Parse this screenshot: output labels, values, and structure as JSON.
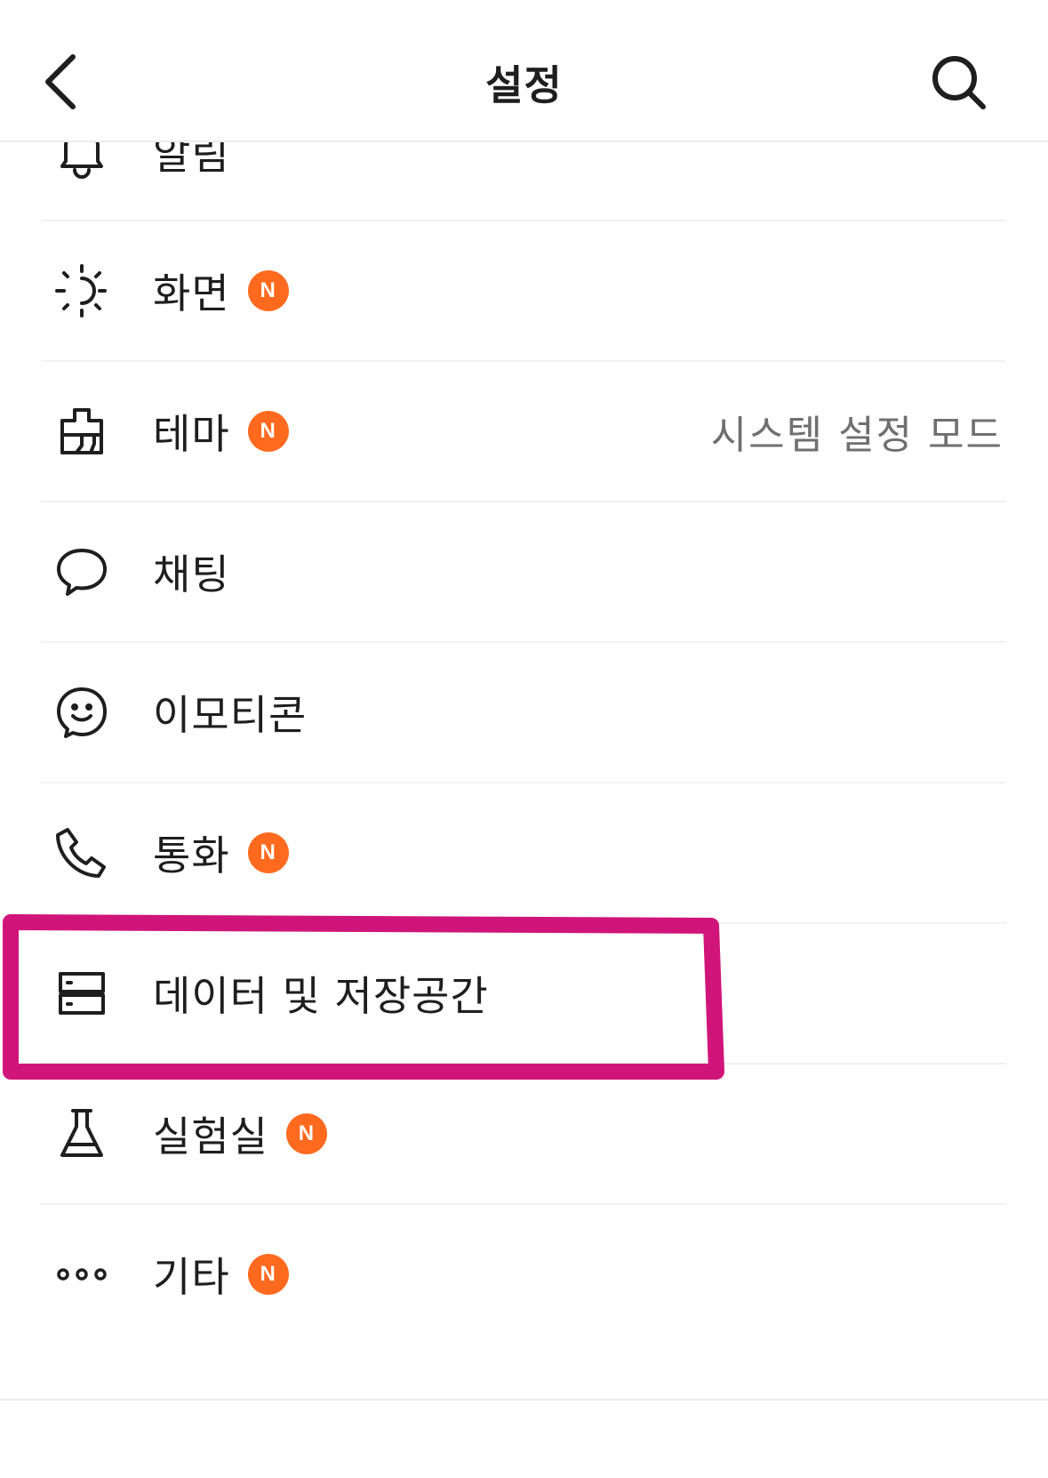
{
  "header": {
    "title": "설정",
    "back_icon": "chevron-left-icon",
    "search_icon": "search-icon"
  },
  "items": [
    {
      "label": "알림",
      "icon": "bell-icon",
      "badge": "",
      "value": ""
    },
    {
      "label": "화면",
      "icon": "brightness-icon",
      "badge": "N",
      "value": ""
    },
    {
      "label": "테마",
      "icon": "theme-brush-icon",
      "badge": "N",
      "value": "시스템 설정 모드"
    },
    {
      "label": "채팅",
      "icon": "chat-bubble-icon",
      "badge": "",
      "value": ""
    },
    {
      "label": "이모티콘",
      "icon": "emoticon-icon",
      "badge": "",
      "value": ""
    },
    {
      "label": "통화",
      "icon": "phone-icon",
      "badge": "N",
      "value": ""
    },
    {
      "label": "데이터 및 저장공간",
      "icon": "storage-icon",
      "badge": "",
      "value": "",
      "highlighted": true
    },
    {
      "label": "실험실",
      "icon": "flask-icon",
      "badge": "N",
      "value": ""
    },
    {
      "label": "기타",
      "icon": "more-dots-icon",
      "badge": "N",
      "value": ""
    }
  ],
  "colors": {
    "badge": "#ff6a1f",
    "highlight_annotation": "#d0157a",
    "divider": "#f1f1f1",
    "value_text": "#6f6f6f"
  }
}
